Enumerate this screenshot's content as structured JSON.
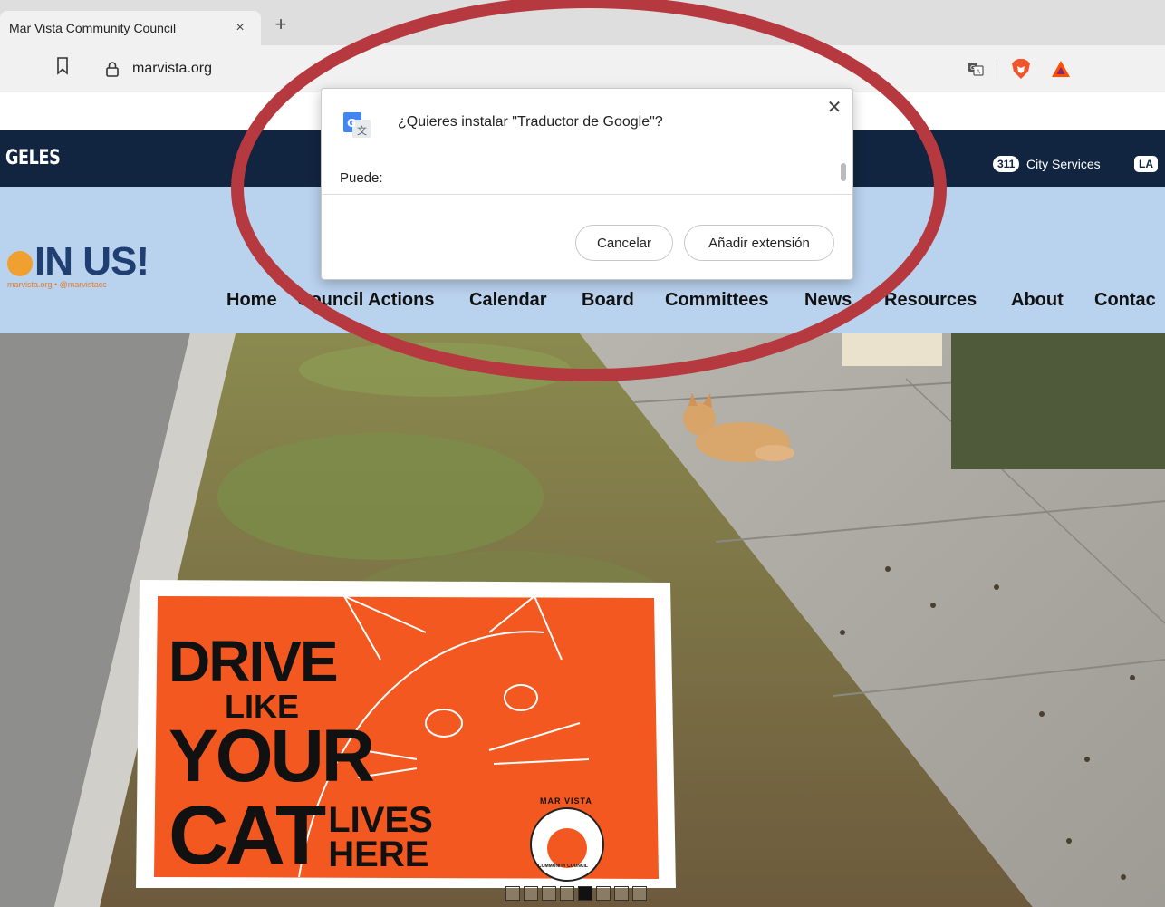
{
  "browser": {
    "tab_title": "Mar Vista Community Council",
    "tab_close": "×",
    "new_tab": "+",
    "url": "marvista.org"
  },
  "site": {
    "city_logo_fragment": "GELES",
    "city_311_badge": "311",
    "city_services": "City Services",
    "city_la_badge": "LA",
    "join_text": "IN US!",
    "join_handles": "marvista.org  •  @marvistacc",
    "nav": [
      "Home",
      "Council Actions",
      "Calendar",
      "Board",
      "Committees",
      "News",
      "Resources",
      "About",
      "Contac"
    ]
  },
  "sign": {
    "line1": "DRIVE",
    "line2": "LIKE",
    "line3": "YOUR",
    "line4": "CAT",
    "line5": "LIVES",
    "line6": "HERE",
    "seal_top": "MAR VISTA",
    "seal_bottom": "COMMUNITY COUNCIL"
  },
  "gallery": {
    "count": 8,
    "active_index": 4
  },
  "dialog": {
    "title": "¿Quieres instalar \"Traductor de Google\"?",
    "close": "✕",
    "subtitle": "Puede:",
    "cancel_label": "Cancelar",
    "add_label": "Añadir extensión"
  },
  "colors": {
    "city_band": "#122540",
    "nav_band": "#b9d2ee",
    "sign_orange": "#f2581f",
    "annotation": "#b6393f"
  },
  "icons": [
    "bookmark-icon",
    "lock-icon",
    "translate-icon",
    "brave-lion-icon",
    "bat-triangle-icon",
    "google-translate-icon",
    "close-icon"
  ]
}
